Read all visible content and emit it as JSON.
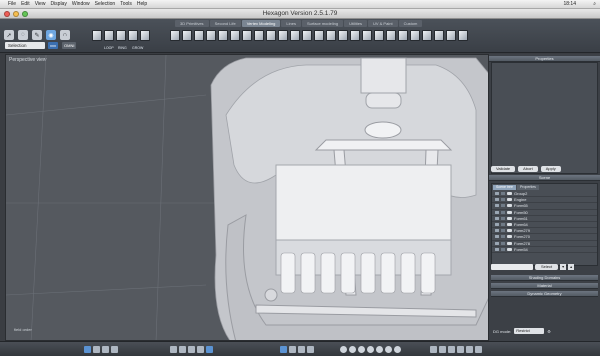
{
  "menubar": {
    "items": [
      "File",
      "Edit",
      "View",
      "Display",
      "Window",
      "Selection",
      "Tools",
      "Help"
    ],
    "clock": "18:14"
  },
  "window": {
    "title": "Hexagon Version 2.5.1.79"
  },
  "toolbar": {
    "tabs": [
      "3D Primitives",
      "Second Life",
      "Vertex Modeling",
      "Lines",
      "Surface modeling",
      "Utilities",
      "UV & Paint",
      "Custom"
    ],
    "active_tab": 2,
    "selection_label": "Selection",
    "sel_badge_1": "xxx",
    "sel_badge_2": "OMNI",
    "loop_label": "Loop",
    "ring_label": "Ring",
    "grow_label": "Grow"
  },
  "viewport": {
    "label": "Perspective view",
    "axis_label": "field order"
  },
  "properties": {
    "title": "Properties",
    "buttons": [
      "Validate",
      "Abort",
      "Apply"
    ]
  },
  "scene": {
    "title": "Scene",
    "tabs": [
      "Scene tree",
      "Properties"
    ],
    "items": [
      "Group2",
      "Engine",
      "Form65",
      "Form50",
      "Form61",
      "Form64",
      "Form279",
      "Form270",
      "Form278",
      "Form54"
    ],
    "select_label": "Select"
  },
  "panels": {
    "shading": "Shading Domains",
    "material": "Material",
    "dynamic": "Dynamic Geometry",
    "dg_mode_label": "DG mode:",
    "dg_mode_value": "Restrict"
  },
  "colors": {
    "accent": "#6ea6e0",
    "panel": "#3c4046",
    "viewport_bg": "#55595f"
  }
}
